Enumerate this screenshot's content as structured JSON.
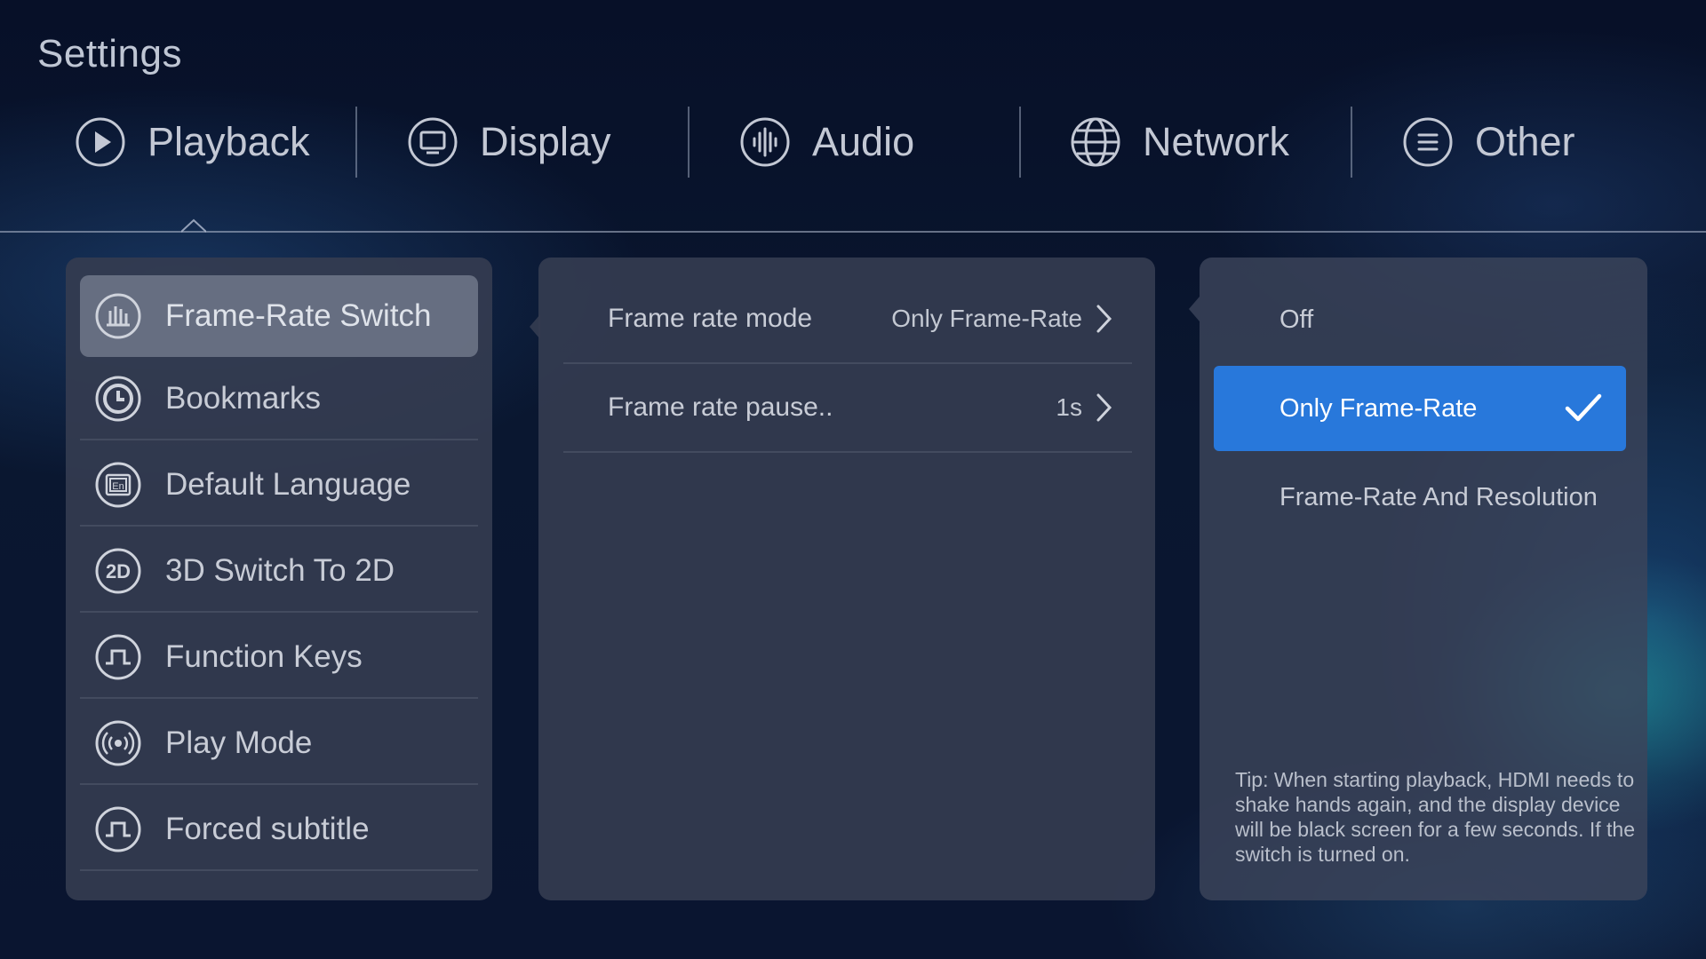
{
  "title": "Settings",
  "tabs": [
    {
      "label": "Playback",
      "icon": "play-circle-icon",
      "active": true
    },
    {
      "label": "Display",
      "icon": "monitor-icon"
    },
    {
      "label": "Audio",
      "icon": "waveform-icon"
    },
    {
      "label": "Network",
      "icon": "globe-icon"
    },
    {
      "label": "Other",
      "icon": "menu-lines-icon"
    }
  ],
  "sidebar": {
    "items": [
      {
        "label": "Frame-Rate Switch",
        "icon": "bar-chart-icon",
        "active": true
      },
      {
        "label": "Bookmarks",
        "icon": "clock-icon"
      },
      {
        "label": "Default Language",
        "icon": "language-en-icon"
      },
      {
        "label": "3D Switch To 2D",
        "icon": "2d-icon"
      },
      {
        "label": "Function Keys",
        "icon": "pulse-icon"
      },
      {
        "label": "Play Mode",
        "icon": "broadcast-icon"
      },
      {
        "label": "Forced subtitle",
        "icon": "pulse-icon"
      }
    ]
  },
  "settings": {
    "rows": [
      {
        "label": "Frame rate mode",
        "value": "Only Frame-Rate"
      },
      {
        "label": "Frame rate pause..",
        "value": "1s"
      }
    ]
  },
  "options": {
    "items": [
      {
        "label": "Off",
        "selected": false
      },
      {
        "label": "Only Frame-Rate",
        "selected": true
      },
      {
        "label": "Frame-Rate And Resolution",
        "selected": false
      }
    ],
    "tip": "Tip: When starting playback, HDMI needs to shake hands again, and the display device will be black screen for a few seconds. If the switch is turned on."
  },
  "colors": {
    "accent": "#2878db",
    "background": "#0a1530",
    "panel": "#343c50"
  }
}
